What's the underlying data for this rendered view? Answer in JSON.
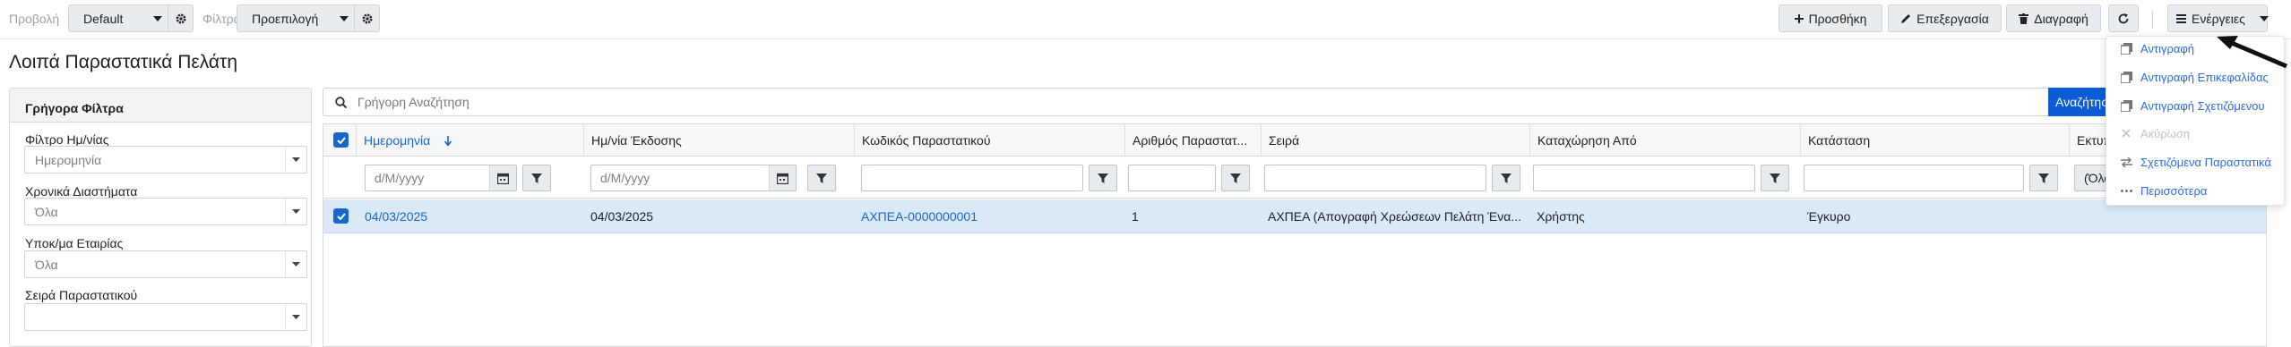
{
  "toolbar": {
    "view_label": "Προβολή",
    "view_value": "Default",
    "filters_label": "Φίλτρα",
    "filters_value": "Προεπιλογή",
    "add_label": "Προσθήκη",
    "edit_label": "Επεξεργασία",
    "delete_label": "Διαγραφή",
    "actions_label": "Ενέργειες"
  },
  "page": {
    "title": "Λοιπά Παραστατικά Πελάτη"
  },
  "quick_filters": {
    "title": "Γρήγορα Φίλτρα",
    "fields": [
      {
        "label": "Φίλτρο Ημ/νίας",
        "value": "Ημερομηνία"
      },
      {
        "label": "Χρονικά Διαστήματα",
        "value": "Όλα"
      },
      {
        "label": "Υποκ/μα Εταιρίας",
        "value": "Όλα"
      },
      {
        "label": "Σειρά Παραστατικού",
        "value": ""
      }
    ]
  },
  "search": {
    "placeholder": "Γρήγορη Αναζήτηση",
    "button_label": "Αναζήτηση"
  },
  "grid": {
    "columns": [
      "Ημερομηνία",
      "Ημ/νία Έκδοσης",
      "Κωδικός Παραστατικού",
      "Αριθμός Παραστατ...",
      "Σειρά",
      "Καταχώρηση Από",
      "Κατάσταση",
      "Εκτυπω"
    ],
    "date_placeholder": "d/M/yyyy",
    "filter_last_label": "(Όλα",
    "rows": [
      {
        "date": "04/03/2025",
        "issue_date": "04/03/2025",
        "code": "ΑΧΠΕΑ-0000000001",
        "number": "1",
        "series": "ΑΧΠΕΑ (Απογραφή Χρεώσεων Πελάτη Ένα...",
        "created_by": "Χρήστης",
        "status": "Έγκυρο"
      }
    ]
  },
  "actions_menu": {
    "items": [
      {
        "label": "Αντιγραφή",
        "icon": "copy-icon",
        "enabled": true
      },
      {
        "label": "Αντιγραφή Επικεφαλίδας",
        "icon": "copy-icon",
        "enabled": true
      },
      {
        "label": "Αντιγραφή Σχετιζόμενου",
        "icon": "copy-icon",
        "enabled": true
      },
      {
        "label": "Ακύρωση",
        "icon": "close-icon",
        "enabled": false
      },
      {
        "label": "Σχετιζόμενα Παραστατικά",
        "icon": "exchange-icon",
        "enabled": true
      },
      {
        "label": "Περισσότερα",
        "icon": "dots-icon",
        "enabled": true
      }
    ]
  },
  "colors": {
    "accent": "#1a66c9",
    "search_button": "#0d5bd7",
    "selected_row": "#dbe8f8"
  }
}
